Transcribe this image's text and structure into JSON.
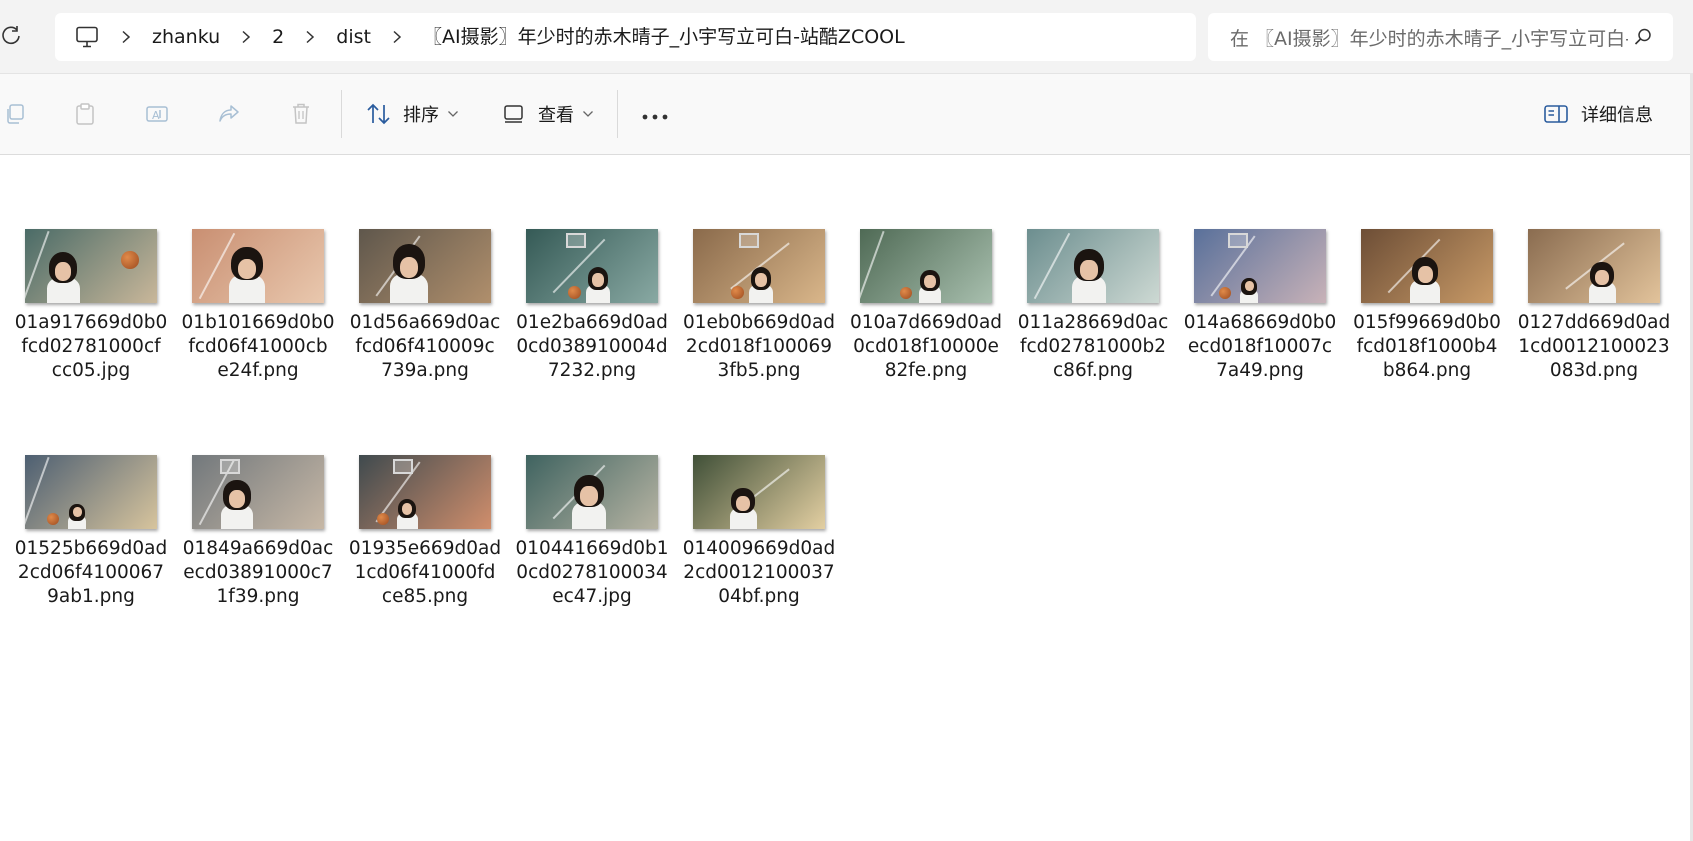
{
  "address_bar": {
    "breadcrumb": [
      "zhanku",
      "2",
      "dist",
      "〖AI摄影〗年少时的赤木晴子_小宇写立可白-站酷ZCOOL"
    ],
    "search_placeholder": "在 〖AI摄影〗年少时的赤木晴子_小宇写立可白-站酷ZCOOL 中搜索"
  },
  "command_bar": {
    "sort_label": "排序",
    "view_label": "查看",
    "details_label": "详细信息"
  },
  "files": [
    {
      "name": "01a917669d0b0fcd02781000cfcc05.jpg",
      "tone": [
        "#4a6b67",
        "#c9b79a"
      ]
    },
    {
      "name": "01b101669d0b0fcd06f41000cbe24f.png",
      "tone": [
        "#c98f72",
        "#e9c8ae"
      ]
    },
    {
      "name": "01d56a669d0acfcd06f410009c739a.png",
      "tone": [
        "#5f574c",
        "#b08f6c"
      ]
    },
    {
      "name": "01e2ba669d0ad0cd038910004d7232.png",
      "tone": [
        "#355a56",
        "#89a9a3"
      ]
    },
    {
      "name": "01eb0b669d0ad2cd018f1000693fb5.png",
      "tone": [
        "#8a6a4b",
        "#d9b68a"
      ]
    },
    {
      "name": "010a7d669d0ad0cd018f10000e82fe.png",
      "tone": [
        "#4f6a55",
        "#a8bfae"
      ]
    },
    {
      "name": "011a28669d0acfcd02781000b2c86f.png",
      "tone": [
        "#6c8e8f",
        "#cdd9d3"
      ]
    },
    {
      "name": "014a68669d0b0ecd018f10007c7a49.png",
      "tone": [
        "#59709a",
        "#c8b2b8"
      ]
    },
    {
      "name": "015f99669d0b0fcd018f1000b4b864.png",
      "tone": [
        "#6d4e36",
        "#c89a67"
      ]
    },
    {
      "name": "0127dd669d0ad1cd0012100023083d.png",
      "tone": [
        "#8a6c50",
        "#e2c39b"
      ]
    },
    {
      "name": "01525b669d0ad2cd06f41000679ab1.png",
      "tone": [
        "#4d5f72",
        "#d7c49d"
      ]
    },
    {
      "name": "01849a669d0acecd03891000c71f39.png",
      "tone": [
        "#72787c",
        "#c7b8a6"
      ]
    },
    {
      "name": "01935e669d0ad1cd06f41000fdce85.png",
      "tone": [
        "#3f4a4e",
        "#d08e6c"
      ]
    },
    {
      "name": "010441669d0b10cd0278100034ec47.jpg",
      "tone": [
        "#3f6360",
        "#b7b4a3"
      ]
    },
    {
      "name": "014009669d0ad2cd001210003704bf.png",
      "tone": [
        "#405038",
        "#e3cfa2"
      ]
    }
  ]
}
